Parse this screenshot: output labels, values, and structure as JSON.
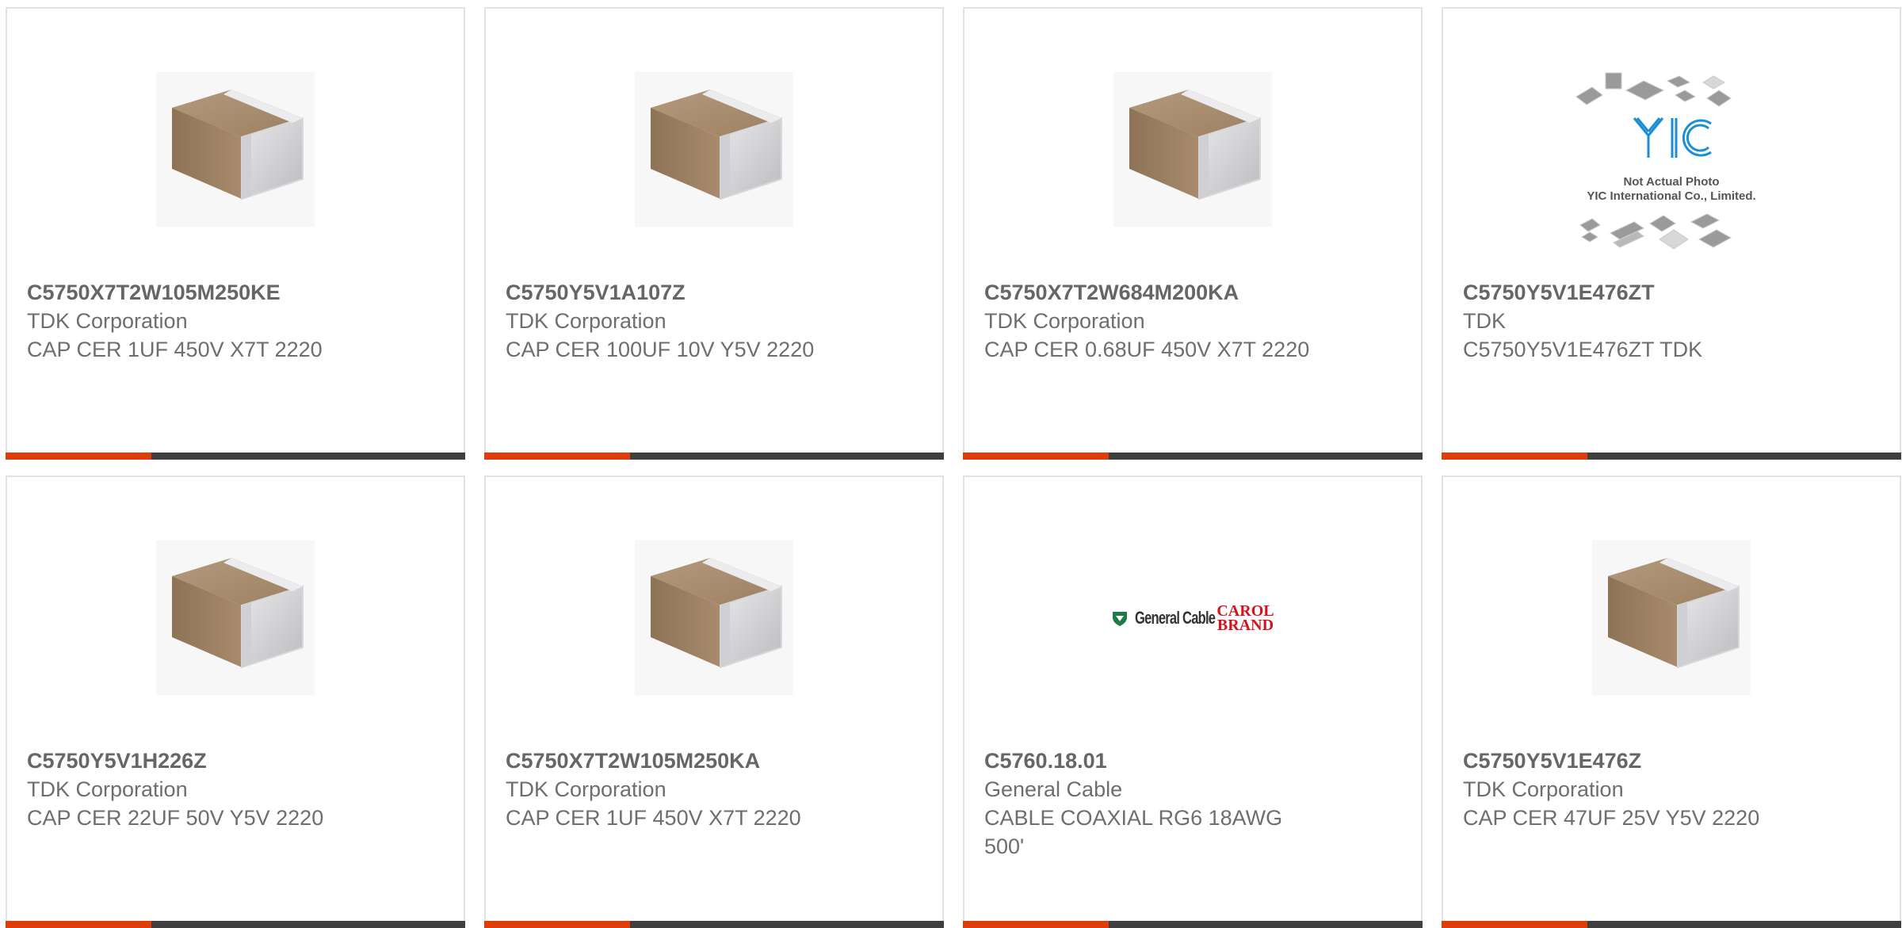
{
  "products": [
    {
      "part_number": "C5750X7T2W105M250KE",
      "manufacturer": "TDK Corporation",
      "description": "CAP CER 1UF 450V X7T 2220",
      "image": "ceramic-capacitor-icon"
    },
    {
      "part_number": "C5750Y5V1A107Z",
      "manufacturer": "TDK Corporation",
      "description": "CAP CER 100UF 10V Y5V 2220",
      "image": "ceramic-capacitor-icon"
    },
    {
      "part_number": "C5750X7T2W684M200KA",
      "manufacturer": "TDK Corporation",
      "description": "CAP CER 0.68UF 450V X7T 2220",
      "image": "ceramic-capacitor-icon"
    },
    {
      "part_number": "C5750Y5V1E476ZT",
      "manufacturer": "TDK",
      "description": "C5750Y5V1E476ZT TDK",
      "image": "yic-placeholder-logo",
      "image_caption_1": "Not Actual Photo",
      "image_caption_2": "YIC International Co., Limited."
    },
    {
      "part_number": "C5750Y5V1H226Z",
      "manufacturer": "TDK Corporation",
      "description": "CAP CER 22UF 50V Y5V 2220",
      "image": "ceramic-capacitor-icon"
    },
    {
      "part_number": "C5750X7T2W105M250KA",
      "manufacturer": "TDK Corporation",
      "description": "CAP CER 1UF 450V X7T 2220",
      "image": "ceramic-capacitor-icon"
    },
    {
      "part_number": "C5760.18.01",
      "manufacturer": "General Cable",
      "description": "CABLE COAXIAL RG6 18AWG 500'",
      "image": "general-cable-carol-logo",
      "logo_text_1": "General Cable",
      "logo_text_2": "CAROL",
      "logo_text_3": "BRAND"
    },
    {
      "part_number": "C5750Y5V1E476Z",
      "manufacturer": "TDK Corporation",
      "description": "CAP CER 47UF 25V Y5V 2220",
      "image": "ceramic-capacitor-icon"
    }
  ],
  "colors": {
    "accent": "#e03c0a",
    "bar": "#3f3f3f",
    "text": "#6e6e6e",
    "border": "#e2e2e2"
  }
}
